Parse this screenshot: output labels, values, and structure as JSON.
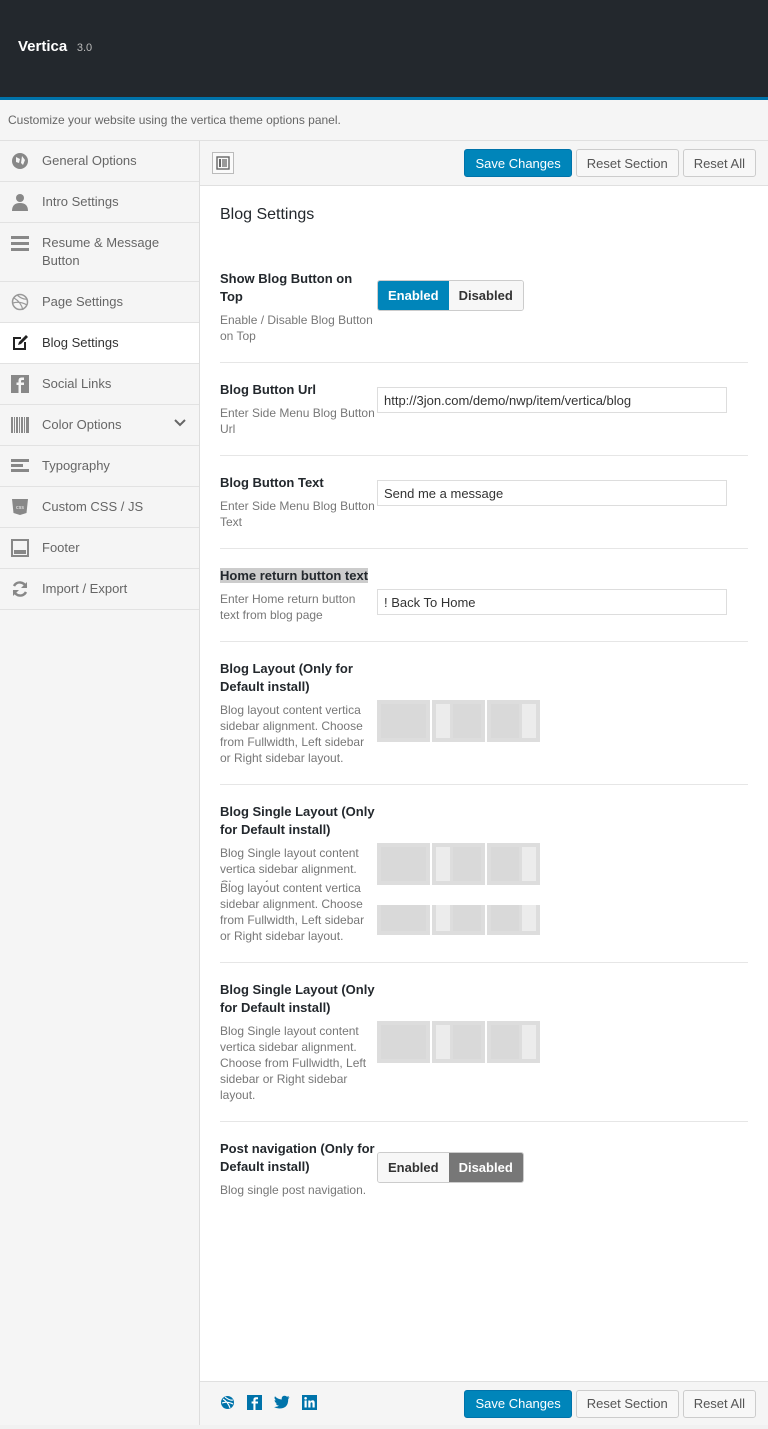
{
  "header": {
    "app_name": "Vertica",
    "version": "3.0"
  },
  "intro_text": "Customize your website using the vertica theme options panel.",
  "sidebar": {
    "items": [
      {
        "label": "General Options",
        "icon": "globe-icon"
      },
      {
        "label": "Intro Settings",
        "icon": "user-icon"
      },
      {
        "label": "Resume & Message Button",
        "icon": "menu-icon"
      },
      {
        "label": "Page Settings",
        "icon": "dribbble-icon"
      },
      {
        "label": "Blog Settings",
        "icon": "edit-icon"
      },
      {
        "label": "Social Links",
        "icon": "facebook-icon"
      },
      {
        "label": "Color Options",
        "icon": "barcode-icon"
      },
      {
        "label": "Typography",
        "icon": "text-icon"
      },
      {
        "label": "Custom CSS / JS",
        "icon": "css-icon"
      },
      {
        "label": "Footer",
        "icon": "footer-icon"
      },
      {
        "label": "Import / Export",
        "icon": "refresh-icon"
      }
    ]
  },
  "toolbar": {
    "save_label": "Save Changes",
    "reset_section_label": "Reset Section",
    "reset_all_label": "Reset All"
  },
  "section": {
    "title": "Blog Settings",
    "fields": {
      "show_blog_button": {
        "title": "Show Blog Button on Top",
        "desc": "Enable / Disable Blog Button on Top",
        "on_label": "Enabled",
        "off_label": "Disabled",
        "value": "Enabled"
      },
      "blog_button_url": {
        "title": "Blog Button Url",
        "desc": "Enter Side Menu Blog Button Url",
        "value": "http://3jon.com/demo/nwp/item/vertica/blog"
      },
      "blog_button_text": {
        "title": "Blog Button Text",
        "desc": "Enter Side Menu Blog Button Text",
        "value": "Send me a message"
      },
      "home_return_text": {
        "title": "Home return button text",
        "desc": "Enter Home return button text from blog page",
        "value": "! Back To Home"
      },
      "blog_layout": {
        "title": "Blog Layout (Only for Default install)",
        "desc": "Blog layout content vertica sidebar alignment. Choose from Fullwidth, Left sidebar or Right sidebar layout."
      },
      "blog_single_layout_1": {
        "title": "Blog Single Layout (Only for Default install)",
        "desc": "Blog Single layout content vertica sidebar alignment. Choose from",
        "overlap_desc": "Blog layout content vertica sidebar alignment. Choose from Fullwidth, Left sidebar or Right sidebar layout."
      },
      "blog_single_layout_2": {
        "title": "Blog Single Layout (Only for Default install)",
        "desc": "Blog Single layout content vertica sidebar alignment. Choose from Fullwidth, Left sidebar or Right sidebar layout."
      },
      "post_navigation": {
        "title": "Post navigation (Only for Default install)",
        "desc": "Blog single post navigation.",
        "on_label": "Enabled",
        "off_label": "Disabled",
        "value": "Disabled"
      }
    }
  },
  "footer_social": [
    "dribbble-icon",
    "facebook-icon",
    "twitter-icon",
    "linkedin-icon"
  ],
  "colors": {
    "accent": "#0085ba",
    "topbar": "#23282d"
  }
}
